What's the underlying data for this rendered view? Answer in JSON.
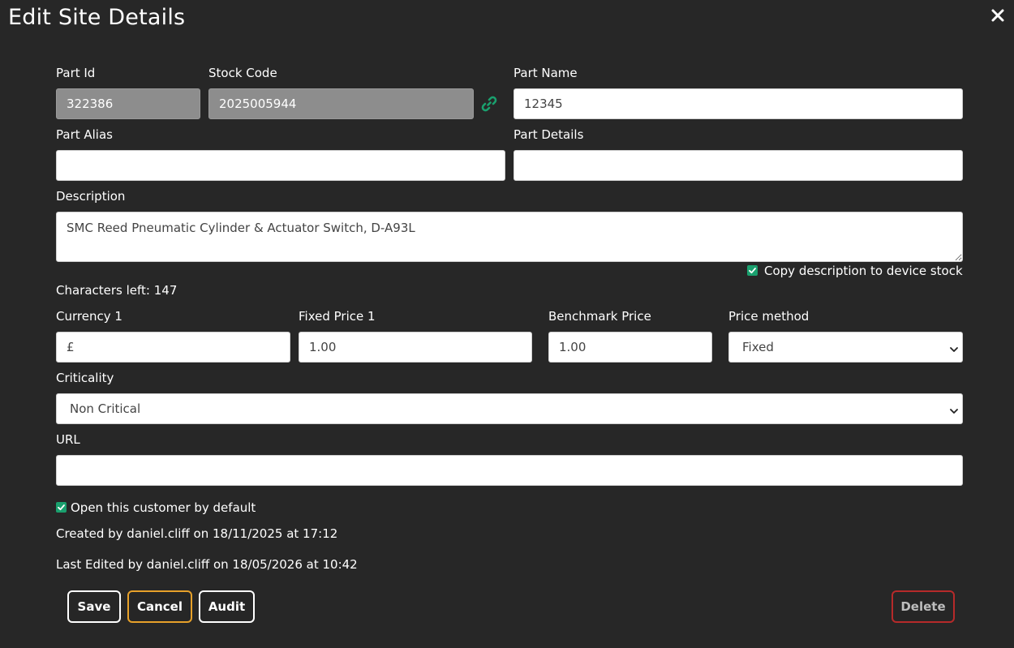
{
  "dialog": {
    "title": "Edit Site Details"
  },
  "fields": {
    "part_id": {
      "label": "Part Id",
      "value": "322386"
    },
    "stock_code": {
      "label": "Stock Code",
      "value": "2025005944"
    },
    "part_name": {
      "label": "Part Name",
      "value": "12345"
    },
    "part_alias": {
      "label": "Part Alias",
      "value": ""
    },
    "part_details": {
      "label": "Part Details",
      "value": ""
    },
    "description": {
      "label": "Description",
      "value": "SMC Reed Pneumatic Cylinder & Actuator Switch, D-A93L"
    },
    "copy_description": {
      "label": "Copy description to device stock",
      "checked": true
    },
    "characters_left": "Characters left: 147",
    "currency1": {
      "label": "Currency 1",
      "value": "£"
    },
    "fixed_price1": {
      "label": "Fixed Price 1",
      "value": "1.00"
    },
    "benchmark_price": {
      "label": "Benchmark Price",
      "value": "1.00"
    },
    "price_method": {
      "label": "Price method",
      "value": "Fixed"
    },
    "criticality": {
      "label": "Criticality",
      "value": "Non Critical"
    },
    "url": {
      "label": "URL",
      "value": ""
    },
    "open_default": {
      "label": "Open this customer by default",
      "checked": true
    }
  },
  "meta": {
    "created": "Created by daniel.cliff on 18/11/2025 at 17:12",
    "edited": "Last Edited by daniel.cliff on 18/05/2026 at 10:42"
  },
  "buttons": {
    "save": "Save",
    "cancel": "Cancel",
    "audit": "Audit",
    "delete": "Delete"
  },
  "colors": {
    "background": "#272727",
    "accent_green": "#1aa06e",
    "cancel_border": "#e7a12a",
    "delete_border": "#b62a2a"
  },
  "icons": {
    "close": "close-icon",
    "link": "link-icon",
    "chevron": "chevron-down-icon",
    "check": "check-icon"
  }
}
